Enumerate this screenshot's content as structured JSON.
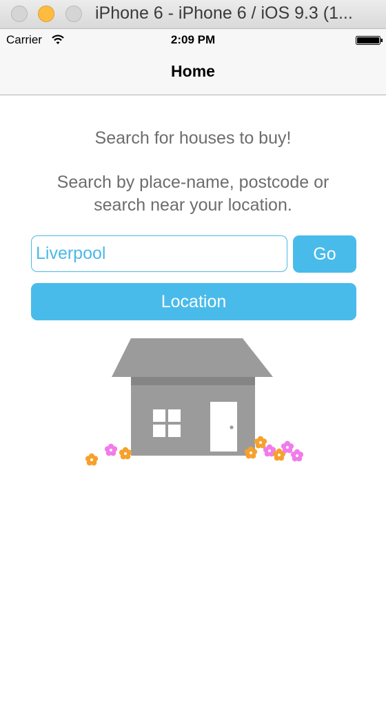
{
  "window": {
    "title": "iPhone 6 - iPhone 6 / iOS 9.3 (1..."
  },
  "status_bar": {
    "carrier": "Carrier",
    "time": "2:09 PM"
  },
  "nav": {
    "title": "Home"
  },
  "main": {
    "headline": "Search for houses to buy!",
    "instructions": "Search by place-name, postcode or search near your location.",
    "search": {
      "value": "Liverpool",
      "placeholder": ""
    },
    "go_label": "Go",
    "location_label": "Location"
  },
  "colors": {
    "accent": "#49bbea",
    "text_gray": "#6d6d6d",
    "house_gray": "#9b9b9b",
    "flower_pink": "#f17ce9",
    "flower_orange": "#f6a12d"
  },
  "icons": [
    "wifi-icon",
    "battery-icon",
    "house-illustration"
  ]
}
